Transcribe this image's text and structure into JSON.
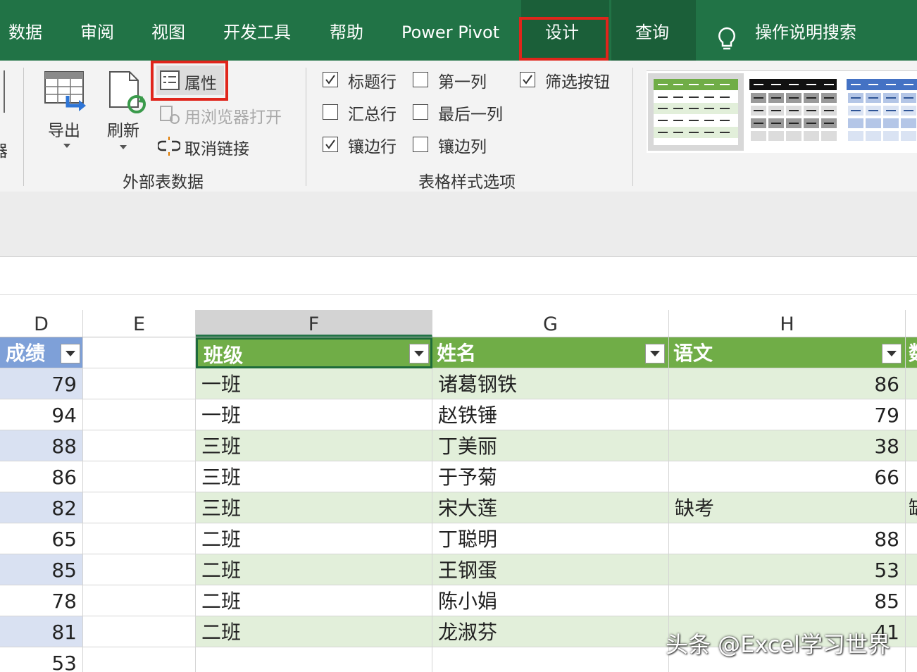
{
  "ribbon_tabs": [
    "数据",
    "审阅",
    "视图",
    "开发工具",
    "帮助",
    "Power Pivot",
    "设计",
    "查询",
    "操作说明搜索"
  ],
  "external_data": {
    "export_label": "导出",
    "refresh_label": "刷新",
    "properties_label": "属性",
    "open_browser_label": "用浏览器打开",
    "unlink_label": "取消链接",
    "group_label": "外部表数据",
    "left_partial": "器"
  },
  "style_options": {
    "header_row": {
      "label": "标题行",
      "checked": true
    },
    "first_column": {
      "label": "第一列",
      "checked": false
    },
    "filter_button": {
      "label": "筛选按钮",
      "checked": true
    },
    "total_row": {
      "label": "汇总行",
      "checked": false
    },
    "last_column": {
      "label": "最后一列",
      "checked": false
    },
    "banded_rows": {
      "label": "镶边行",
      "checked": true
    },
    "banded_columns": {
      "label": "镶边列",
      "checked": false
    },
    "group_label": "表格样式选项"
  },
  "columns": [
    "D",
    "E",
    "F",
    "G",
    "H"
  ],
  "table": {
    "headers": {
      "d": "成绩",
      "f": "班级",
      "g": "姓名",
      "h": "语文",
      "i_partial": "数"
    },
    "rows": [
      {
        "d": "79",
        "f": "一班",
        "g": "诸葛钢铁",
        "h": "86"
      },
      {
        "d": "94",
        "f": "一班",
        "g": "赵铁锤",
        "h": "79"
      },
      {
        "d": "88",
        "f": "三班",
        "g": "丁美丽",
        "h": "38"
      },
      {
        "d": "86",
        "f": "三班",
        "g": "于予菊",
        "h": "66"
      },
      {
        "d": "82",
        "f": "三班",
        "g": "宋大莲",
        "h": "缺考",
        "i_partial": "缺"
      },
      {
        "d": "65",
        "f": "二班",
        "g": "丁聪明",
        "h": "88"
      },
      {
        "d": "85",
        "f": "二班",
        "g": "王钢蛋",
        "h": "53"
      },
      {
        "d": "78",
        "f": "二班",
        "g": "陈小娟",
        "h": "85"
      },
      {
        "d": "81",
        "f": "二班",
        "g": "龙淑芬",
        "h": "41"
      },
      {
        "d": "53",
        "f": "",
        "g": "",
        "h": ""
      }
    ]
  },
  "watermark": "头条 @Excel学习世界",
  "colors": {
    "ribbon_green": "#217346",
    "table_header": "#70ad47",
    "band_row": "#e2efda",
    "highlight_red": "#e0251b",
    "d_column_band": "#d9e1f2"
  }
}
